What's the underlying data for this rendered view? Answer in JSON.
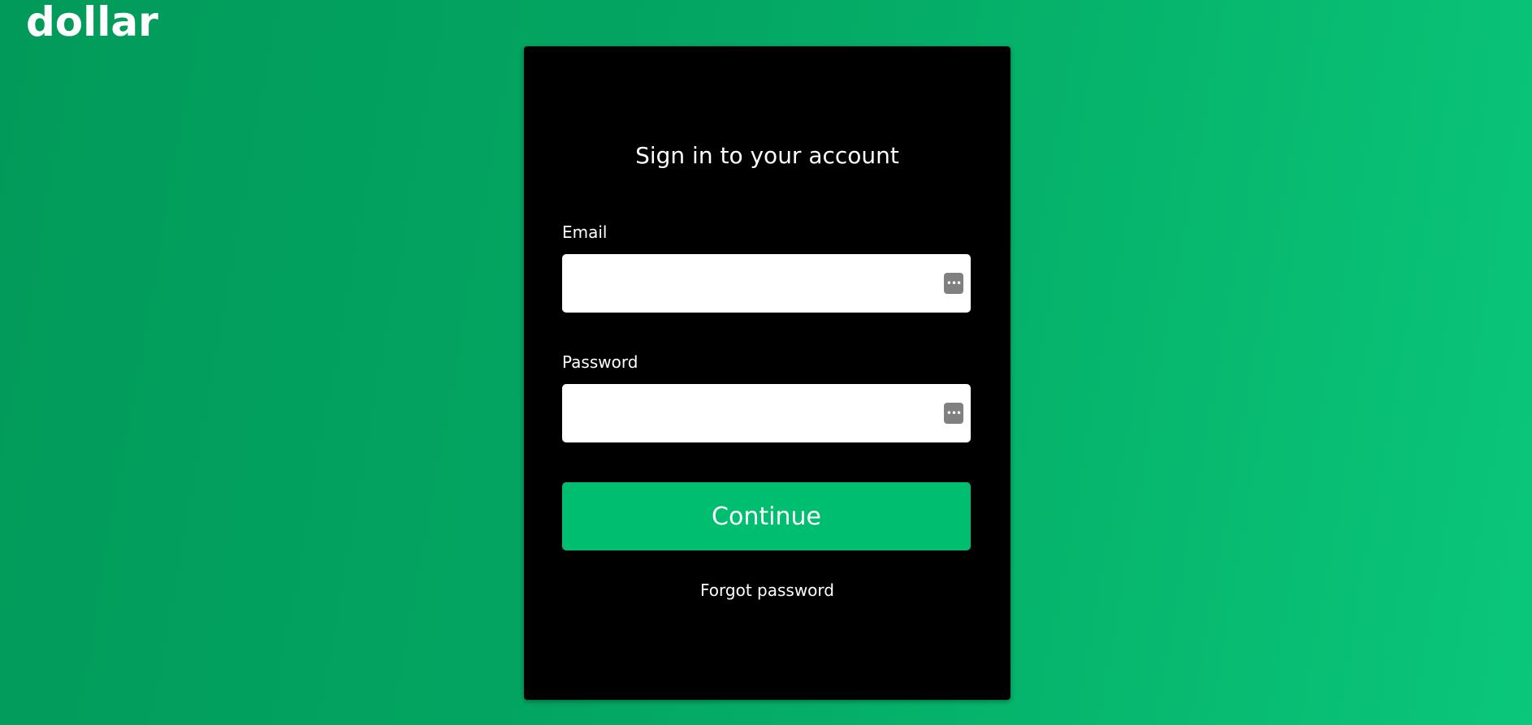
{
  "brand": {
    "logo": "dollar"
  },
  "login": {
    "title": "Sign in to your account",
    "email_label": "Email",
    "email_value": "",
    "password_label": "Password",
    "password_value": "",
    "field_icon": "password-manager-icon",
    "continue_label": "Continue",
    "forgot_label": "Forgot password"
  },
  "colors": {
    "accent": "#00be70",
    "card": "#000000",
    "background": "#03a562"
  }
}
